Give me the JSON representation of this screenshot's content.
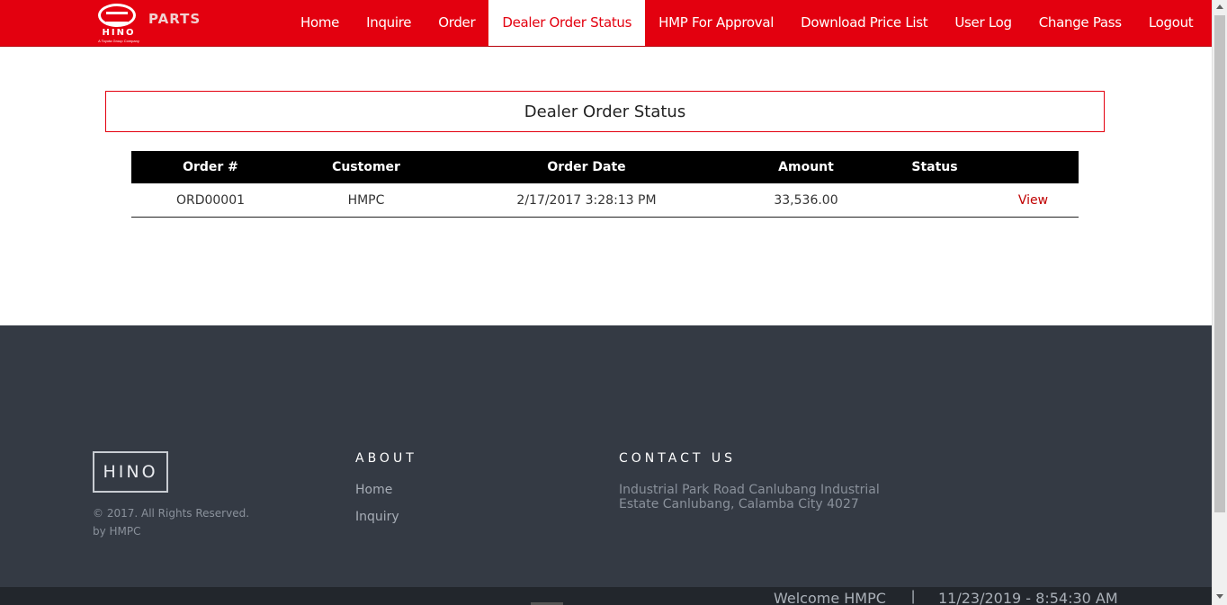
{
  "header": {
    "logo_text": "HINO",
    "logo_tagline": "A Toyota Group Company",
    "brand_suffix": "PARTS",
    "nav": [
      {
        "label": "Home",
        "active": false
      },
      {
        "label": "Inquire",
        "active": false
      },
      {
        "label": "Order",
        "active": false
      },
      {
        "label": "Dealer Order Status",
        "active": true
      },
      {
        "label": "HMP For Approval",
        "active": false
      },
      {
        "label": "Download Price List",
        "active": false
      },
      {
        "label": "User Log",
        "active": false
      },
      {
        "label": "Change Pass",
        "active": false
      },
      {
        "label": "Logout",
        "active": false
      }
    ]
  },
  "main": {
    "title": "Dealer Order Status",
    "table": {
      "columns": [
        "Order #",
        "Customer",
        "Order Date",
        "Amount",
        "Status",
        ""
      ],
      "rows": [
        {
          "order_no": "ORD00001",
          "customer": "HMPC",
          "order_date": "2/17/2017 3:28:13 PM",
          "amount": "33,536.00",
          "status": "",
          "action": "View"
        }
      ]
    }
  },
  "footer": {
    "logo": "HINO",
    "copyright": "© 2017. All Rights Reserved.",
    "byline": "by HMPC",
    "about_heading": "ABOUT",
    "about_links": [
      "Home",
      "Inquiry"
    ],
    "contact_heading": "CONTACT US",
    "address": "Industrial Park Road Canlubang Industrial Estate Canlubang, Calamba City 4027"
  },
  "status_bar": {
    "welcome": "Welcome HMPC",
    "separator": "|",
    "datetime": "11/23/2019 - 8:54:30 AM"
  },
  "colors": {
    "brand_red": "#e3000f",
    "footer_bg": "#343a44",
    "table_header_bg": "#000000",
    "link_red": "#c00000"
  }
}
